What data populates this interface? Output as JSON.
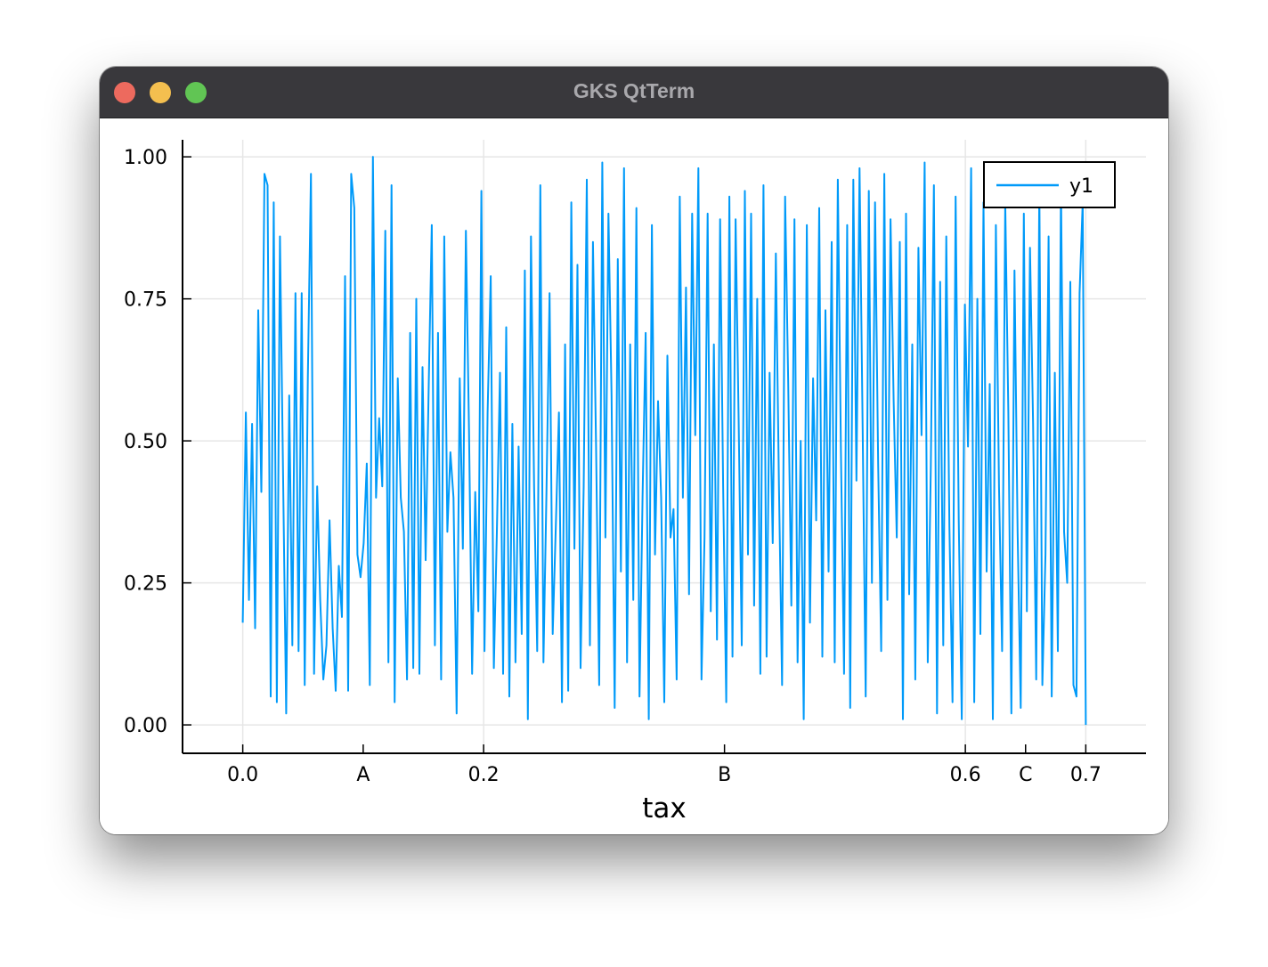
{
  "window": {
    "title": "GKS QtTerm"
  },
  "chart_data": {
    "type": "line",
    "title": "",
    "xlabel": "tax",
    "ylabel": "",
    "xlim": [
      -0.05,
      0.75
    ],
    "ylim": [
      -0.05,
      1.03
    ],
    "grid": true,
    "legend_position": "top-right",
    "x_ticks": [
      {
        "value": 0.0,
        "label": "0.0"
      },
      {
        "value": 0.1,
        "label": "A"
      },
      {
        "value": 0.2,
        "label": "0.2"
      },
      {
        "value": 0.4,
        "label": "B"
      },
      {
        "value": 0.6,
        "label": "0.6"
      },
      {
        "value": 0.65,
        "label": "C"
      },
      {
        "value": 0.7,
        "label": "0.7"
      }
    ],
    "y_ticks": [
      {
        "value": 0.0,
        "label": "0.00"
      },
      {
        "value": 0.25,
        "label": "0.25"
      },
      {
        "value": 0.5,
        "label": "0.50"
      },
      {
        "value": 0.75,
        "label": "0.75"
      },
      {
        "value": 1.0,
        "label": "1.00"
      }
    ],
    "x_range": [
      0.0,
      0.7
    ],
    "series": [
      {
        "name": "y1",
        "color": "#009af9",
        "values": [
          0.18,
          0.55,
          0.22,
          0.53,
          0.17,
          0.73,
          0.41,
          0.97,
          0.95,
          0.05,
          0.92,
          0.04,
          0.86,
          0.44,
          0.02,
          0.58,
          0.14,
          0.76,
          0.13,
          0.76,
          0.07,
          0.61,
          0.97,
          0.09,
          0.42,
          0.22,
          0.08,
          0.14,
          0.36,
          0.17,
          0.06,
          0.28,
          0.19,
          0.79,
          0.06,
          0.97,
          0.91,
          0.3,
          0.26,
          0.32,
          0.46,
          0.07,
          1.0,
          0.4,
          0.54,
          0.42,
          0.87,
          0.11,
          0.95,
          0.04,
          0.61,
          0.4,
          0.34,
          0.08,
          0.69,
          0.1,
          0.75,
          0.09,
          0.63,
          0.29,
          0.6,
          0.88,
          0.14,
          0.69,
          0.08,
          0.86,
          0.34,
          0.48,
          0.4,
          0.02,
          0.61,
          0.31,
          0.87,
          0.52,
          0.09,
          0.41,
          0.2,
          0.94,
          0.13,
          0.55,
          0.79,
          0.1,
          0.34,
          0.62,
          0.09,
          0.7,
          0.05,
          0.53,
          0.11,
          0.49,
          0.16,
          0.8,
          0.01,
          0.86,
          0.42,
          0.13,
          0.95,
          0.11,
          0.41,
          0.76,
          0.16,
          0.35,
          0.55,
          0.04,
          0.67,
          0.06,
          0.92,
          0.31,
          0.81,
          0.1,
          0.42,
          0.96,
          0.14,
          0.85,
          0.49,
          0.07,
          0.99,
          0.33,
          0.9,
          0.58,
          0.03,
          0.82,
          0.27,
          0.98,
          0.11,
          0.67,
          0.22,
          0.91,
          0.05,
          0.4,
          0.69,
          0.01,
          0.88,
          0.3,
          0.57,
          0.4,
          0.04,
          0.65,
          0.33,
          0.38,
          0.08,
          0.93,
          0.4,
          0.77,
          0.23,
          0.9,
          0.51,
          0.98,
          0.08,
          0.33,
          0.9,
          0.2,
          0.67,
          0.15,
          0.89,
          0.42,
          0.04,
          0.93,
          0.12,
          0.89,
          0.54,
          0.14,
          0.94,
          0.3,
          0.9,
          0.21,
          0.75,
          0.09,
          0.95,
          0.12,
          0.62,
          0.32,
          0.83,
          0.42,
          0.07,
          0.93,
          0.6,
          0.21,
          0.89,
          0.11,
          0.5,
          0.01,
          0.88,
          0.18,
          0.61,
          0.36,
          0.91,
          0.12,
          0.73,
          0.27,
          0.85,
          0.11,
          0.96,
          0.48,
          0.09,
          0.88,
          0.03,
          0.96,
          0.43,
          0.98,
          0.52,
          0.05,
          0.94,
          0.25,
          0.92,
          0.46,
          0.13,
          0.97,
          0.22,
          0.89,
          0.57,
          0.33,
          0.85,
          0.01,
          0.9,
          0.23,
          0.67,
          0.08,
          0.84,
          0.51,
          0.99,
          0.11,
          0.45,
          0.95,
          0.02,
          0.78,
          0.14,
          0.86,
          0.35,
          0.04,
          0.93,
          0.36,
          0.01,
          0.74,
          0.49,
          0.98,
          0.04,
          0.75,
          0.16,
          0.92,
          0.27,
          0.6,
          0.01,
          0.88,
          0.42,
          0.13,
          0.92,
          0.55,
          0.02,
          0.8,
          0.34,
          0.03,
          0.9,
          0.2,
          0.84,
          0.53,
          0.08,
          0.95,
          0.07,
          0.3,
          0.86,
          0.05,
          0.62,
          0.13,
          0.95,
          0.34,
          0.25,
          0.78,
          0.07,
          0.05,
          0.76,
          0.92,
          0.0
        ]
      }
    ]
  }
}
